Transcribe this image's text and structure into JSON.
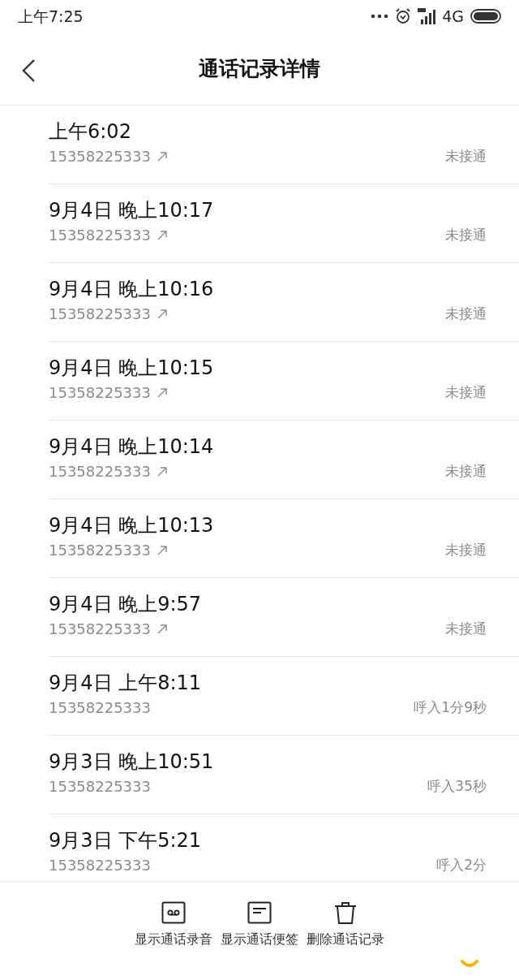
{
  "status_bar": {
    "time": "上午7:25",
    "network": "4G"
  },
  "header": {
    "title": "通话记录详情"
  },
  "calls": [
    {
      "time": "上午6:02",
      "number": "15358225333",
      "kind": "outgoing",
      "result": "未接通"
    },
    {
      "time": "9月4日 晚上10:17",
      "number": "15358225333",
      "kind": "outgoing",
      "result": "未接通"
    },
    {
      "time": "9月4日 晚上10:16",
      "number": "15358225333",
      "kind": "outgoing",
      "result": "未接通"
    },
    {
      "time": "9月4日 晚上10:15",
      "number": "15358225333",
      "kind": "outgoing",
      "result": "未接通"
    },
    {
      "time": "9月4日 晚上10:14",
      "number": "15358225333",
      "kind": "outgoing",
      "result": "未接通"
    },
    {
      "time": "9月4日 晚上10:13",
      "number": "15358225333",
      "kind": "outgoing",
      "result": "未接通"
    },
    {
      "time": "9月4日 晚上9:57",
      "number": "15358225333",
      "kind": "outgoing",
      "result": "未接通"
    },
    {
      "time": "9月4日 上午8:11",
      "number": "15358225333",
      "kind": "incoming",
      "result": "呼入1分9秒"
    },
    {
      "time": "9月3日 晚上10:51",
      "number": "15358225333",
      "kind": "incoming",
      "result": "呼入35秒"
    },
    {
      "time": "9月3日 下午5:21",
      "number": "15358225333",
      "kind": "incoming",
      "result": "呼入2分"
    }
  ],
  "toolbar": [
    {
      "kind": "recording",
      "label": "显示通话录音"
    },
    {
      "kind": "note",
      "label": "显示通话便签"
    },
    {
      "kind": "delete",
      "label": "删除通话记录"
    }
  ]
}
